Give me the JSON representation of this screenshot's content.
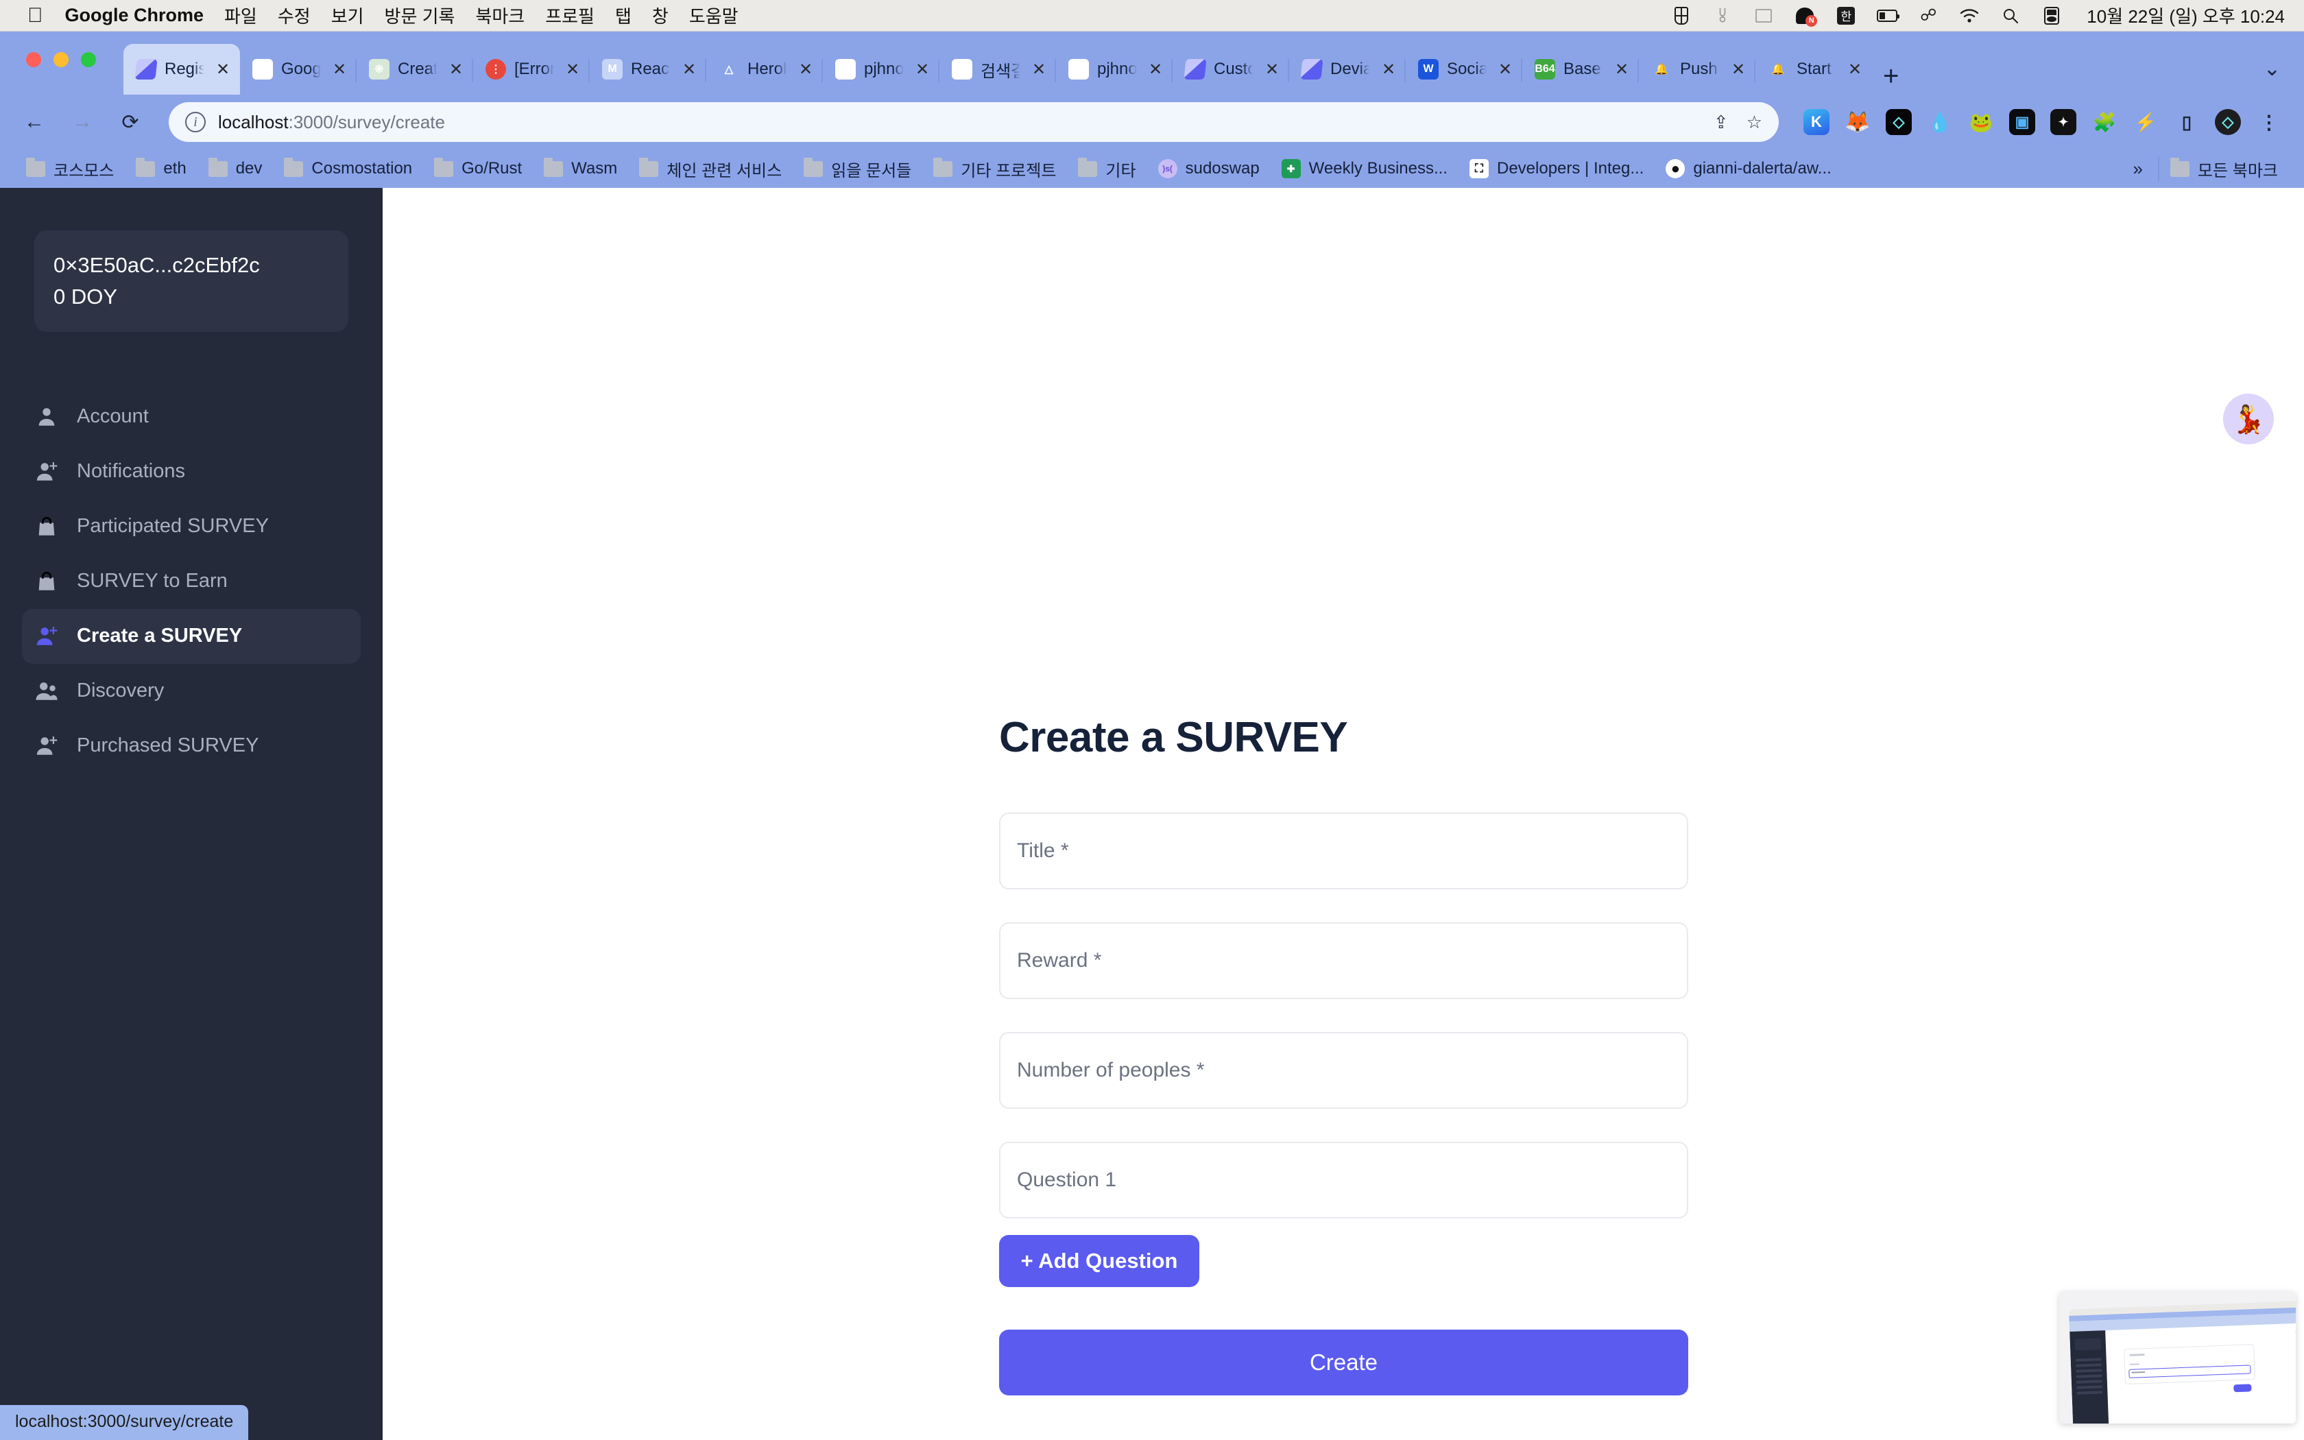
{
  "macos_menubar": {
    "apple_icon": "apple-logo-icon",
    "app_name": "Google Chrome",
    "menus": [
      "파일",
      "수정",
      "보기",
      "방문 기록",
      "북마크",
      "프로필",
      "탭",
      "창",
      "도움말"
    ],
    "status_icons": [
      "grid-icon",
      "stethoscope-icon",
      "display-icon",
      "naver-whale-icon",
      "korean-input-icon",
      "battery-icon",
      "bluetooth-icon",
      "wifi-icon",
      "spotlight-search-icon",
      "control-center-icon"
    ],
    "clock": "10월 22일 (일) 오후 10:24"
  },
  "browser": {
    "tabs": [
      {
        "label": "Regis",
        "favicon": "survey-app-icon",
        "active": true
      },
      {
        "label": "Goog",
        "favicon": "google-translate-icon",
        "active": false
      },
      {
        "label": "Creat",
        "favicon": "openai-icon",
        "active": false
      },
      {
        "label": "[Error",
        "favicon": "error-icon",
        "active": false
      },
      {
        "label": "React",
        "favicon": "react-mui-icon",
        "active": false
      },
      {
        "label": "Herok",
        "favicon": "heroku-icon",
        "active": false
      },
      {
        "label": "pjhno",
        "favicon": "github-icon",
        "active": false
      },
      {
        "label": "검색결",
        "favicon": "gmail-icon",
        "active": false
      },
      {
        "label": "pjhno",
        "favicon": "github-icon",
        "active": false
      },
      {
        "label": "Custo",
        "favicon": "survey-app-icon",
        "active": false
      },
      {
        "label": "Devia",
        "favicon": "survey-app-icon",
        "active": false
      },
      {
        "label": "Socia",
        "favicon": "w-blue-icon",
        "active": false
      },
      {
        "label": "Base",
        "favicon": "base64-icon",
        "active": false
      },
      {
        "label": "Push",
        "favicon": "bell-icon",
        "active": false
      },
      {
        "label": "Start",
        "favicon": "bell-icon",
        "active": false
      }
    ],
    "tab_close_label": "✕",
    "new_tab_label": "+",
    "tab_search_label": "⌄",
    "nav": {
      "back_label": "←",
      "forward_label": "→",
      "reload_label": "⟳"
    },
    "omnibox": {
      "info_icon": "site-info-icon",
      "url_bold": "localhost",
      "url_rest": ":3000/survey/create",
      "share_icon": "share-icon",
      "bookmark_icon": "star-icon"
    },
    "extensions": [
      {
        "name": "kaikas-extension-icon",
        "glyph": "K"
      },
      {
        "name": "metamask-extension-icon",
        "glyph": "🦊"
      },
      {
        "name": "ens-extension-icon",
        "glyph": "◈"
      },
      {
        "name": "water-drop-extension-icon",
        "glyph": "💧"
      },
      {
        "name": "frog-extension-icon",
        "glyph": "🐸"
      },
      {
        "name": "phantom-wallet-extension-icon",
        "glyph": "◧"
      },
      {
        "name": "argent-extension-icon",
        "glyph": "✦"
      },
      {
        "name": "puzzle-extensions-icon",
        "glyph": "🧩"
      },
      {
        "name": "leaf-extension-icon",
        "glyph": "⚡"
      },
      {
        "name": "pocket-extension-icon",
        "glyph": "▯"
      },
      {
        "name": "ens-round-extension-icon",
        "glyph": "◈"
      },
      {
        "name": "chrome-menu-icon",
        "glyph": "⋮"
      }
    ],
    "bookmarks": [
      {
        "label": "코스모스",
        "icon": "folder-icon"
      },
      {
        "label": "eth",
        "icon": "folder-icon"
      },
      {
        "label": "dev",
        "icon": "folder-icon"
      },
      {
        "label": "Cosmostation",
        "icon": "folder-icon"
      },
      {
        "label": "Go/Rust",
        "icon": "folder-icon"
      },
      {
        "label": "Wasm",
        "icon": "folder-icon"
      },
      {
        "label": "체인 관련 서비스",
        "icon": "folder-icon"
      },
      {
        "label": "읽을 문서들",
        "icon": "folder-icon"
      },
      {
        "label": "기타 프로젝트",
        "icon": "folder-icon"
      },
      {
        "label": "기타",
        "icon": "folder-icon"
      },
      {
        "label": "sudoswap",
        "icon": "sudoswap-icon"
      },
      {
        "label": "Weekly Business...",
        "icon": "google-sheets-icon"
      },
      {
        "label": "Developers | Integ...",
        "icon": "developers-icon"
      },
      {
        "label": "gianni-dalerta/aw...",
        "icon": "github-icon"
      }
    ],
    "bookmarks_overflow_label": "»",
    "all_bookmarks_label": "모든 북마크",
    "status_bubble": "localhost:3000/survey/create"
  },
  "app": {
    "sidebar": {
      "wallet": {
        "address": "0×3E50aC...c2cEbf2c",
        "balance": "0 DOY"
      },
      "items": [
        {
          "label": "Account",
          "icon": "person-icon",
          "active": false
        },
        {
          "label": "Notifications",
          "icon": "person-add-icon",
          "active": false
        },
        {
          "label": "Participated SURVEY",
          "icon": "bag-icon",
          "active": false
        },
        {
          "label": "SURVEY to Earn",
          "icon": "bag-icon",
          "active": false
        },
        {
          "label": "Create a SURVEY",
          "icon": "person-add-icon",
          "active": true
        },
        {
          "label": "Discovery",
          "icon": "people-icon",
          "active": false
        },
        {
          "label": "Purchased SURVEY",
          "icon": "person-add-icon",
          "active": false
        }
      ]
    },
    "header": {
      "avatar_icon": "user-avatar-emoji"
    },
    "main": {
      "title": "Create a SURVEY",
      "fields": [
        {
          "name": "title",
          "placeholder": "Title *",
          "value": ""
        },
        {
          "name": "reward",
          "placeholder": "Reward *",
          "value": ""
        },
        {
          "name": "number_of_peoples",
          "placeholder": "Number of peoples *",
          "value": ""
        },
        {
          "name": "question_1",
          "placeholder": "Question 1",
          "value": ""
        }
      ],
      "add_question_label": "+ Add Question",
      "create_label": "Create"
    },
    "pip": {
      "name": "screen-recording-thumbnail"
    },
    "colors": {
      "accent": "#5b5bf0",
      "sidebar_bg": "#242a3a",
      "sidebar_card": "#2e3446",
      "title": "#16213a",
      "placeholder": "#6b7280",
      "chrome_frame": "#8ba4e8"
    }
  }
}
